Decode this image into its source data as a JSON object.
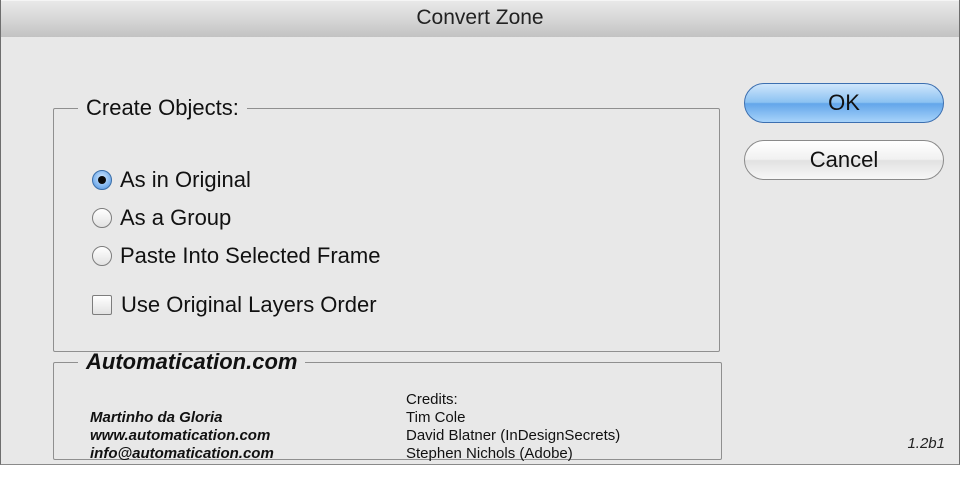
{
  "window": {
    "title": "Convert Zone"
  },
  "create_objects": {
    "legend": "Create Objects:",
    "options": [
      {
        "label": "As in Original",
        "selected": true
      },
      {
        "label": "As a Group",
        "selected": false
      },
      {
        "label": "Paste Into Selected Frame",
        "selected": false
      }
    ],
    "checkbox": {
      "label": "Use Original Layers Order",
      "checked": false
    }
  },
  "buttons": {
    "ok": "OK",
    "cancel": "Cancel"
  },
  "credits": {
    "legend": "Automatication.com",
    "author": [
      "Martinho da Gloria",
      "www.automatication.com",
      "info@automatication.com"
    ],
    "heading": "Credits:",
    "names": [
      "Tim Cole",
      "David Blatner (InDesignSecrets)",
      "Stephen Nichols (Adobe)"
    ]
  },
  "version": "1.2b1",
  "colors": {
    "accent": "#63a6ea",
    "window_bg": "#e8e8e8"
  }
}
